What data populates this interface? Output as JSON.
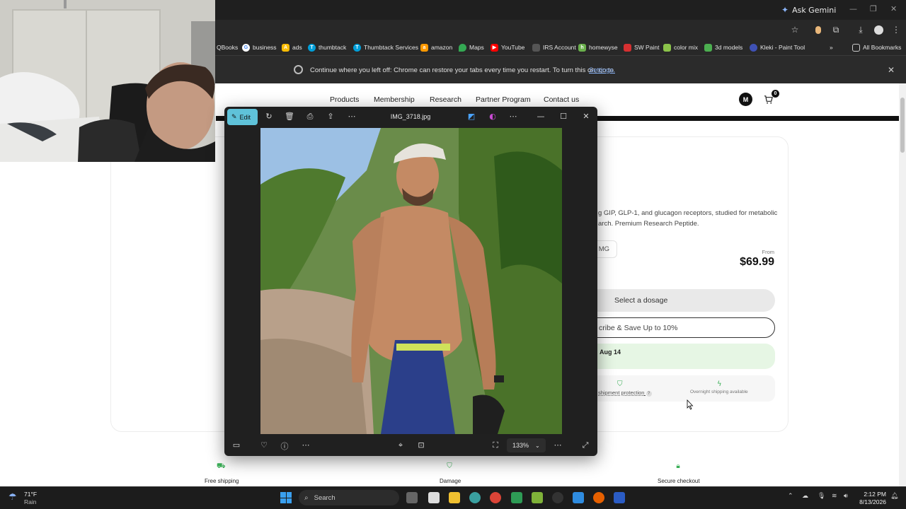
{
  "browser": {
    "ask_gemini": "Ask Gemini",
    "bookmarks": [
      {
        "label": "QBooks",
        "icon": "quickbooks-icon",
        "color": "#2ca01c"
      },
      {
        "label": "business",
        "icon": "google-icon",
        "color": "#4285f4"
      },
      {
        "label": "ads",
        "icon": "google-ads-icon",
        "color": "#fbbc04"
      },
      {
        "label": "thumbtack",
        "icon": "thumbtack-icon",
        "color": "#009fd9"
      },
      {
        "label": "Thumbtack Services",
        "icon": "thumbtack-icon",
        "color": "#009fd9"
      },
      {
        "label": "amazon",
        "icon": "amazon-icon",
        "color": "#ff9900"
      },
      {
        "label": "Maps",
        "icon": "maps-icon",
        "color": "#34a853"
      },
      {
        "label": "YouTube",
        "icon": "youtube-icon",
        "color": "#ff0000"
      },
      {
        "label": "IRS Account",
        "icon": "irs-icon",
        "color": "#555555"
      },
      {
        "label": "homewyse",
        "icon": "homewyse-icon",
        "color": "#6ab04c"
      },
      {
        "label": "SW Paint",
        "icon": "sherwin-williams-icon",
        "color": "#d63031"
      },
      {
        "label": "color mix",
        "icon": "color-mix-icon",
        "color": "#8bc34a"
      },
      {
        "label": "3d models",
        "icon": "3d-models-icon",
        "color": "#4caf50"
      },
      {
        "label": "Kleki - Paint Tool",
        "icon": "kleki-icon",
        "color": "#3f51b5"
      }
    ],
    "all_bookmarks": "All Bookmarks",
    "restore_message": "Continue where you left off: Chrome can restore your tabs every time you restart. To turn this on, go to",
    "restore_link": "Settings."
  },
  "site": {
    "nav": [
      "Products",
      "Membership",
      "Research",
      "Partner Program",
      "Contact us"
    ],
    "avatar_initial": "M",
    "cart_count": "0",
    "description_line1": "g GIP, GLP-1, and glucagon receptors, studied for metabolic",
    "description_line2": "arch. Premium Research Peptide.",
    "size_chip": "MG",
    "price_from_label": "From",
    "price": "$69.99",
    "select_dosage": "Select a dosage",
    "subscribe": "cribe & Save Up to 10%",
    "delivery_date": "Aug 14",
    "perk_protection": "shipment protection",
    "perk_overnight": "Overnight shipping available",
    "features": [
      "Free shipping",
      "Damage",
      "Secure checkout"
    ],
    "accent_color": "#3aaf57"
  },
  "viewer": {
    "edit_label": "Edit",
    "file_name": "IMG_3718.jpg",
    "zoom": "133%"
  },
  "taskbar": {
    "temperature": "71°F",
    "condition": "Rain",
    "search_placeholder": "Search",
    "time": "2:12 PM",
    "date": "8/13/2026"
  }
}
